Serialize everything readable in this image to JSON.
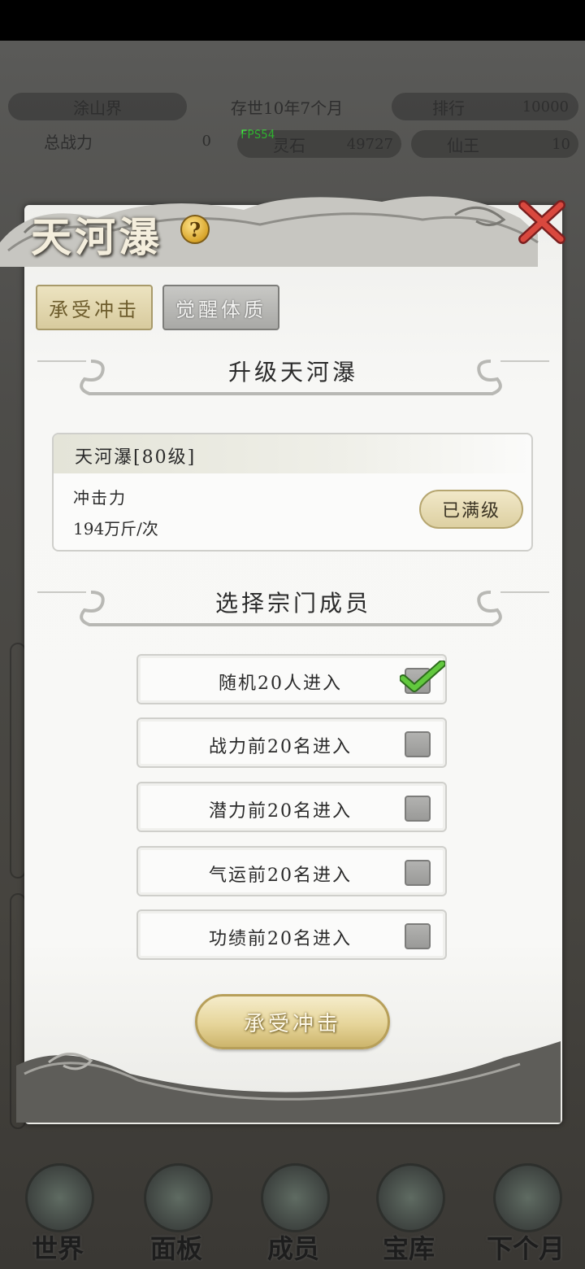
{
  "hud": {
    "realm": "涂山界",
    "age": "存世10年7个月",
    "rank_label": "排行",
    "rank_value": "10000",
    "power_label": "总战力",
    "power_value": "0",
    "fps": "FPS54",
    "stone_label": "灵石",
    "stone_value": "49727",
    "immortal_label": "仙王",
    "immortal_value": "10"
  },
  "bottom_nav": [
    {
      "label": "世界"
    },
    {
      "label": "面板"
    },
    {
      "label": "成员"
    },
    {
      "label": "宝库"
    },
    {
      "label": "下个月"
    }
  ],
  "modal": {
    "title": "天河瀑",
    "help": "?",
    "tabs": [
      {
        "label": "承受冲击",
        "active": true
      },
      {
        "label": "觉醒体质",
        "active": false
      }
    ],
    "upgrade_section_title": "升级天河瀑",
    "info": {
      "name": "天河瀑[80级]",
      "stat_label": "冲击力",
      "stat_value": "194万斤/次",
      "status_button": "已满级"
    },
    "select_section_title": "选择宗门成员",
    "options": [
      {
        "label": "随机20人进入",
        "checked": true
      },
      {
        "label": "战力前20名进入",
        "checked": false
      },
      {
        "label": "潜力前20名进入",
        "checked": false
      },
      {
        "label": "气运前20名进入",
        "checked": false
      },
      {
        "label": "功绩前20名进入",
        "checked": false
      }
    ],
    "confirm_button": "承受冲击"
  },
  "colors": {
    "accent_gold": "#d8cb9e",
    "check_green": "#58c23a",
    "close_red": "#c7393a"
  }
}
